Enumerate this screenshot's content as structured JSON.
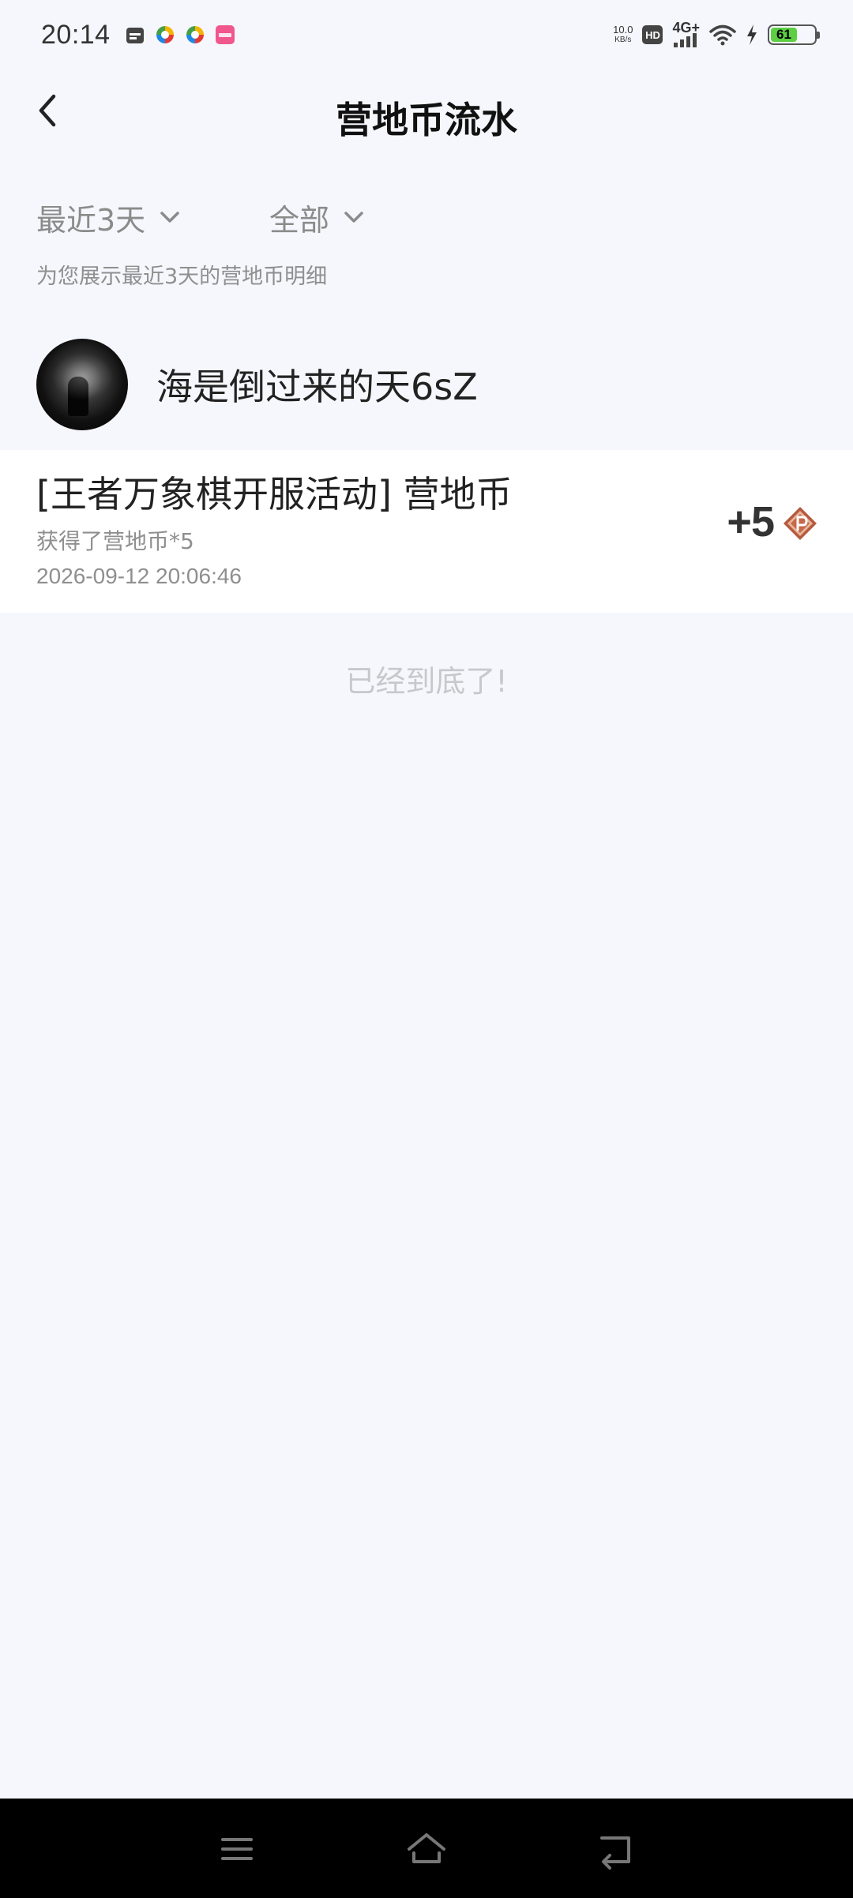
{
  "status_bar": {
    "time": "20:14",
    "speed_value": "10.0",
    "speed_unit": "KB/s",
    "hd": "HD",
    "network": "4G+",
    "battery": "61",
    "battery_percent": 61,
    "icons": [
      "calendar-icon",
      "app-icon",
      "app-icon",
      "app-icon",
      "wifi-icon",
      "charging-icon",
      "battery-icon"
    ]
  },
  "header": {
    "title": "营地币流水",
    "back_icon": "chevron-left-icon"
  },
  "filters": {
    "range_label": "最近3天",
    "type_label": "全部",
    "hint": "为您展示最近3天的营地币明细"
  },
  "user": {
    "name": "海是倒过来的天6sZ"
  },
  "transactions": [
    {
      "title": "[王者万象棋开服活动] 营地币",
      "description": "获得了营地币*5",
      "time": "2026-09-12 20:06:46",
      "amount": "+5",
      "icon": "coin-icon"
    }
  ],
  "end_text": "已经到底了!",
  "nav": {
    "icons": [
      "menu-icon",
      "home-icon",
      "back-icon"
    ]
  },
  "colors": {
    "background": "#f6f7fc",
    "card": "#ffffff",
    "muted_text": "#8f8f8f",
    "battery_green": "#5ccf43",
    "coin": "#c7684a"
  }
}
